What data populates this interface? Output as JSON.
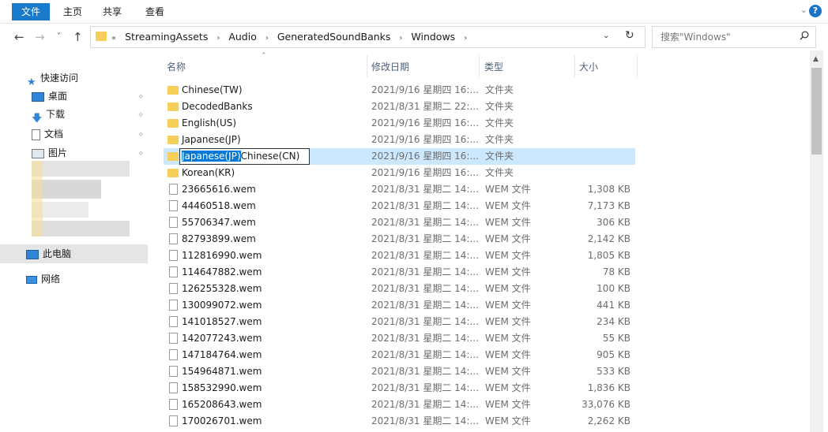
{
  "ribbon": {
    "tabs": [
      "文件",
      "主页",
      "共享",
      "查看"
    ]
  },
  "address": {
    "overflow": "«",
    "crumbs": [
      "StreamingAssets",
      "Audio",
      "GeneratedSoundBanks",
      "Windows"
    ]
  },
  "search": {
    "placeholder": "搜索\"Windows\""
  },
  "sidebar": {
    "quick_access": "快速访问",
    "items": [
      "桌面",
      "下载",
      "文档",
      "图片"
    ],
    "this_pc": "此电脑",
    "network": "网络"
  },
  "columns": [
    "名称",
    "修改日期",
    "类型",
    "大小"
  ],
  "rename": {
    "selected": "Japanese(JP)",
    "rest": "Chinese(CN)"
  },
  "rows": [
    {
      "name": "Chinese(TW)",
      "date": "2021/9/16 星期四 16:...",
      "type": "文件夹",
      "size": ""
    },
    {
      "name": "DecodedBanks",
      "date": "2021/8/31 星期二 22:...",
      "type": "文件夹",
      "size": ""
    },
    {
      "name": "English(US)",
      "date": "2021/9/16 星期四 16:...",
      "type": "文件夹",
      "size": ""
    },
    {
      "name": "Japanese(JP)",
      "date": "2021/9/16 星期四 16:...",
      "type": "文件夹",
      "size": ""
    },
    {
      "name": "",
      "date": "2021/9/16 星期四 16:...",
      "type": "文件夹",
      "size": ""
    },
    {
      "name": "Korean(KR)",
      "date": "2021/9/16 星期四 16:...",
      "type": "文件夹",
      "size": ""
    },
    {
      "name": "23665616.wem",
      "date": "2021/8/31 星期二 14:...",
      "type": "WEM 文件",
      "size": "1,308 KB"
    },
    {
      "name": "44460518.wem",
      "date": "2021/8/31 星期二 14:...",
      "type": "WEM 文件",
      "size": "7,173 KB"
    },
    {
      "name": "55706347.wem",
      "date": "2021/8/31 星期二 14:...",
      "type": "WEM 文件",
      "size": "306 KB"
    },
    {
      "name": "82793899.wem",
      "date": "2021/8/31 星期二 14:...",
      "type": "WEM 文件",
      "size": "2,142 KB"
    },
    {
      "name": "112816990.wem",
      "date": "2021/8/31 星期二 14:...",
      "type": "WEM 文件",
      "size": "1,805 KB"
    },
    {
      "name": "114647882.wem",
      "date": "2021/8/31 星期二 14:...",
      "type": "WEM 文件",
      "size": "78 KB"
    },
    {
      "name": "126255328.wem",
      "date": "2021/8/31 星期二 14:...",
      "type": "WEM 文件",
      "size": "100 KB"
    },
    {
      "name": "130099072.wem",
      "date": "2021/8/31 星期二 14:...",
      "type": "WEM 文件",
      "size": "441 KB"
    },
    {
      "name": "141018527.wem",
      "date": "2021/8/31 星期二 14:...",
      "type": "WEM 文件",
      "size": "234 KB"
    },
    {
      "name": "142077243.wem",
      "date": "2021/8/31 星期二 14:...",
      "type": "WEM 文件",
      "size": "55 KB"
    },
    {
      "name": "147184764.wem",
      "date": "2021/8/31 星期二 14:...",
      "type": "WEM 文件",
      "size": "905 KB"
    },
    {
      "name": "154964871.wem",
      "date": "2021/8/31 星期二 14:...",
      "type": "WEM 文件",
      "size": "533 KB"
    },
    {
      "name": "158532990.wem",
      "date": "2021/8/31 星期二 14:...",
      "type": "WEM 文件",
      "size": "1,836 KB"
    },
    {
      "name": "165208643.wem",
      "date": "2021/8/31 星期二 14:...",
      "type": "WEM 文件",
      "size": "33,076 KB"
    },
    {
      "name": "170026701.wem",
      "date": "2021/8/31 星期二 14:...",
      "type": "WEM 文件",
      "size": "2,262 KB"
    }
  ],
  "colors": {
    "accent": "#1979ca",
    "selection": "#cce8ff",
    "folder": "#f6cf5b"
  }
}
